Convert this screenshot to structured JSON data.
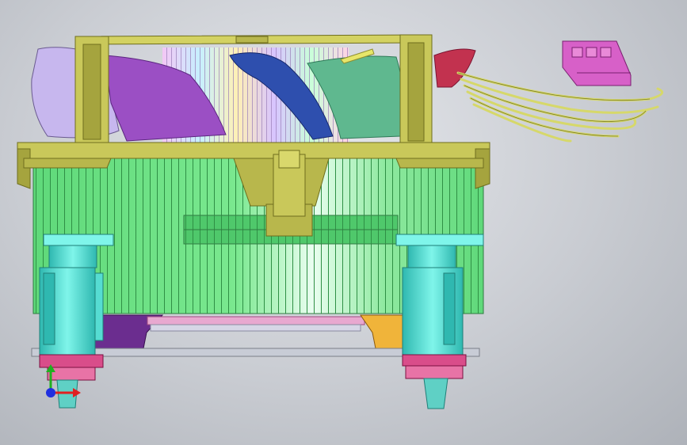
{
  "scene": {
    "subject": "cpu-cooler-cad-model",
    "view": "front-elevation",
    "colors": {
      "heatsink_fins": "#5fd97a",
      "heatsink_highlight": "#e9fff0",
      "frame": "#c9c85a",
      "frame_dark": "#8f8e2e",
      "fan_blade_lilac": "#c7b7ee",
      "fan_blade_purple": "#9b4fc4",
      "fan_blade_blue": "#2e4fae",
      "fan_blade_teal": "#5fb88f",
      "fan_blade_red": "#c2324f",
      "push_pin": "#3fe0d0",
      "mount_base_pink": "#d94d8a",
      "base_plate_purple": "#6b2d8f",
      "base_plate_orange": "#f0b43a",
      "connector": "#d760c8",
      "wires": "#d6d86a"
    },
    "axis_triad": {
      "x_color": "#e02020",
      "y_color": "#20b020",
      "z_color": "#2030e0"
    }
  }
}
